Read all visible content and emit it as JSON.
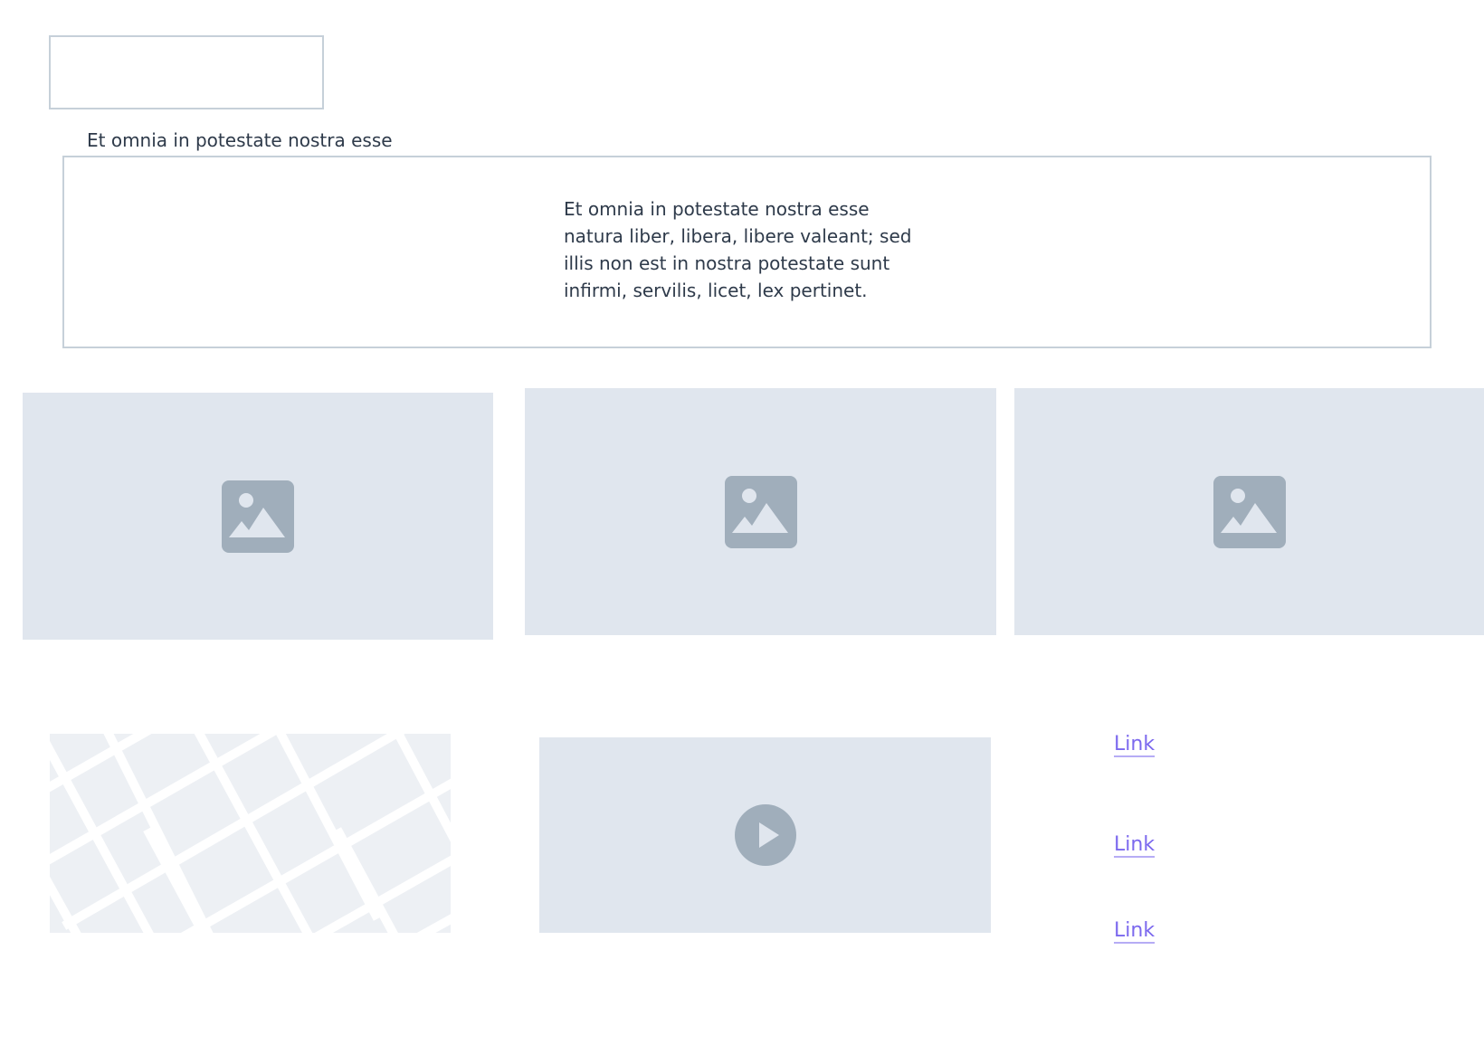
{
  "form": {
    "top_input_value": "",
    "field_label": "Et omnia in potestate nostra esse",
    "textarea_text": "Et omnia in potestate nostra esse natura liber, libera, libere valeant; sed illis non est in nostra potestate sunt infirmi, servilis, licet, lex pertinet."
  },
  "images": [
    {
      "icon": "image-icon"
    },
    {
      "icon": "image-icon"
    },
    {
      "icon": "image-icon"
    }
  ],
  "map": {
    "icon": "map-placeholder"
  },
  "video": {
    "icon": "play-icon"
  },
  "links": [
    {
      "label": "Link"
    },
    {
      "label": "Link"
    },
    {
      "label": "Link"
    }
  ],
  "colors": {
    "placeholder_bg": "#e0e6ee",
    "placeholder_icon": "#a0aebb",
    "border": "#c6d0d9",
    "link": "#7b68ee",
    "text": "#2e3a4a"
  }
}
